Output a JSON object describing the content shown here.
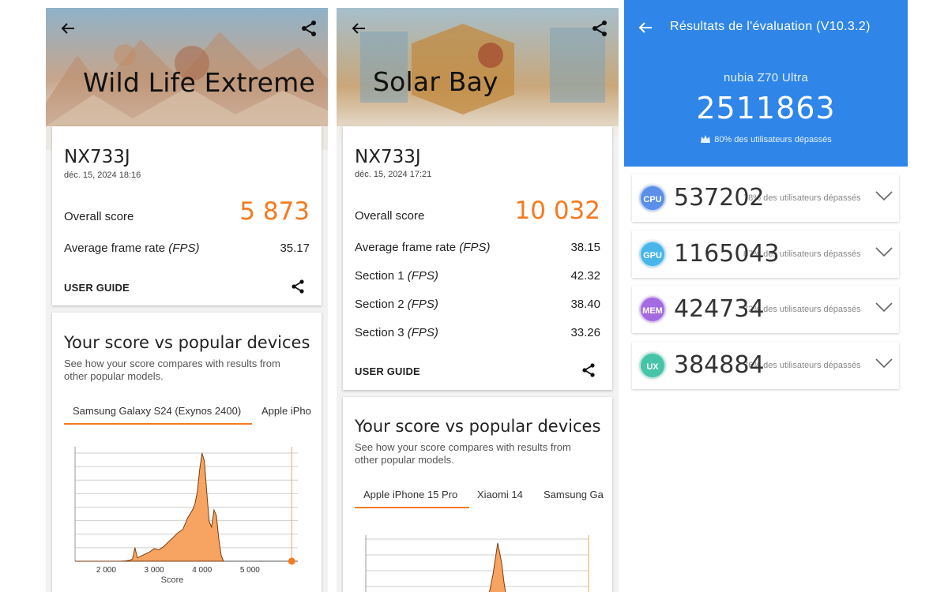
{
  "colors": {
    "accent_orange": "#f47a20",
    "blue_header": "#2f86e8",
    "cpu": "#5b8fe8",
    "gpu": "#49b5e8",
    "mem": "#a46ae0",
    "ux": "#46c4a8"
  },
  "panel1": {
    "test_name": "Wild Life Extreme",
    "device": "NX733J",
    "date": "déc. 15, 2024 18:16",
    "overall_label": "Overall score",
    "overall_value": "5 873",
    "fps_label": "Average frame rate ",
    "fps_unit": "(FPS)",
    "fps_value": "35.17",
    "guide": "USER GUIDE",
    "compare_title": "Your score vs popular devices",
    "compare_sub": "See how your score compares with results from other popular models.",
    "tabs": [
      "Samsung Galaxy S24 (Exynos 2400)",
      "Apple iPho"
    ],
    "chart_data": {
      "type": "area",
      "xlabel": "Score",
      "tick_labels": [
        "2 000",
        "3 000",
        "4 000",
        "5 000"
      ],
      "x_ticks": [
        2000,
        3000,
        4000,
        5000
      ],
      "xlim": [
        1350,
        6000
      ],
      "user_score": 5873,
      "x": [
        1350,
        1900,
        2300,
        2400,
        2500,
        2550,
        2600,
        2650,
        2700,
        2800,
        2900,
        3000,
        3100,
        3200,
        3300,
        3400,
        3500,
        3600,
        3700,
        3800,
        3850,
        3900,
        3950,
        4000,
        4050,
        4100,
        4150,
        4200,
        4250,
        4300,
        4350,
        4400,
        4450
      ],
      "values": [
        0,
        0,
        0,
        0.3,
        1,
        2,
        12,
        3,
        4,
        6,
        8,
        11,
        10,
        13,
        17,
        21,
        25,
        28,
        38,
        45,
        50,
        60,
        80,
        95,
        88,
        60,
        35,
        30,
        45,
        40,
        20,
        5,
        0
      ]
    }
  },
  "panel2": {
    "test_name": "Solar Bay",
    "device": "NX733J",
    "date": "déc. 15, 2024 17:21",
    "overall_label": "Overall score",
    "overall_value": "10 032",
    "rows": [
      {
        "label": "Average frame rate ",
        "unit": "(FPS)",
        "value": "38.15"
      },
      {
        "label": "Section 1 ",
        "unit": "(FPS)",
        "value": "42.32"
      },
      {
        "label": "Section 2 ",
        "unit": "(FPS)",
        "value": "38.40"
      },
      {
        "label": "Section 3 ",
        "unit": "(FPS)",
        "value": "33.26"
      }
    ],
    "guide": "USER GUIDE",
    "compare_title": "Your score vs popular devices",
    "compare_sub": "See how your score compares with results from other popular models.",
    "tabs": [
      "Apple iPhone 15 Pro",
      "Xiaomi 14",
      "Samsung Ga"
    ]
  },
  "panel3": {
    "title": "Résultats de l'évaluation (V10.3.2)",
    "device": "nubia Z70 Ultra",
    "score": "2511863",
    "percent": "80% des utilisateurs dépassés",
    "items": [
      {
        "badge": "CPU",
        "score": "537202",
        "pct": "78% des utilisateurs dépassés",
        "color": "#5b8fe8"
      },
      {
        "badge": "GPU",
        "score": "1165043",
        "pct": "87% des utilisateurs dépassés",
        "color": "#49b5e8"
      },
      {
        "badge": "MEM",
        "score": "424734",
        "pct": "72% des utilisateurs dépassés",
        "color": "#a46ae0"
      },
      {
        "badge": "UX",
        "score": "384884",
        "pct": "76% des utilisateurs dépassés",
        "color": "#46c4a8"
      }
    ]
  }
}
